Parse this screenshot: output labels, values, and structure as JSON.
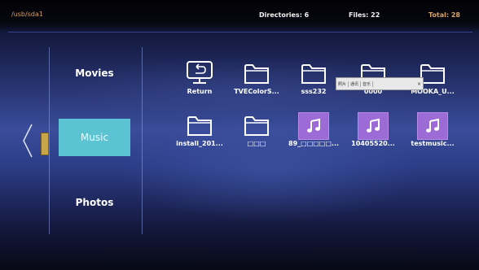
{
  "header": {
    "path": "/usb/sda1",
    "directories": "Directories: 6",
    "files": "Files: 22",
    "total": "Total: 28"
  },
  "sidebar": {
    "items": [
      {
        "label": "Movies",
        "selected": false
      },
      {
        "label": "Music",
        "selected": true
      },
      {
        "label": "Photos",
        "selected": false
      }
    ]
  },
  "grid": {
    "row1": [
      {
        "label": "Return",
        "icon": "return-icon"
      },
      {
        "label": "TVEColorS...",
        "icon": "folder-icon"
      },
      {
        "label": "sss232",
        "icon": "folder-icon"
      },
      {
        "label": "0000",
        "icon": "folder-icon"
      },
      {
        "label": "MOOKA_U...",
        "icon": "folder-icon"
      }
    ],
    "row2": [
      {
        "label": "install_201...",
        "icon": "folder-icon"
      },
      {
        "label": "□□□",
        "icon": "folder-icon"
      },
      {
        "label": "89_□□□□□...",
        "icon": "music-note-icon"
      },
      {
        "label": "10405520...",
        "icon": "music-note-icon"
      },
      {
        "label": "testmusic...",
        "icon": "music-note-icon"
      }
    ]
  },
  "popup": {
    "items": [
      "照片",
      "通讯",
      "音乐"
    ],
    "close": "×"
  },
  "colors": {
    "selected_category": "#5bc3d1",
    "music_tile": "#9c6bd6",
    "path_text": "#d8a060",
    "total_text": "#d9a46a"
  }
}
